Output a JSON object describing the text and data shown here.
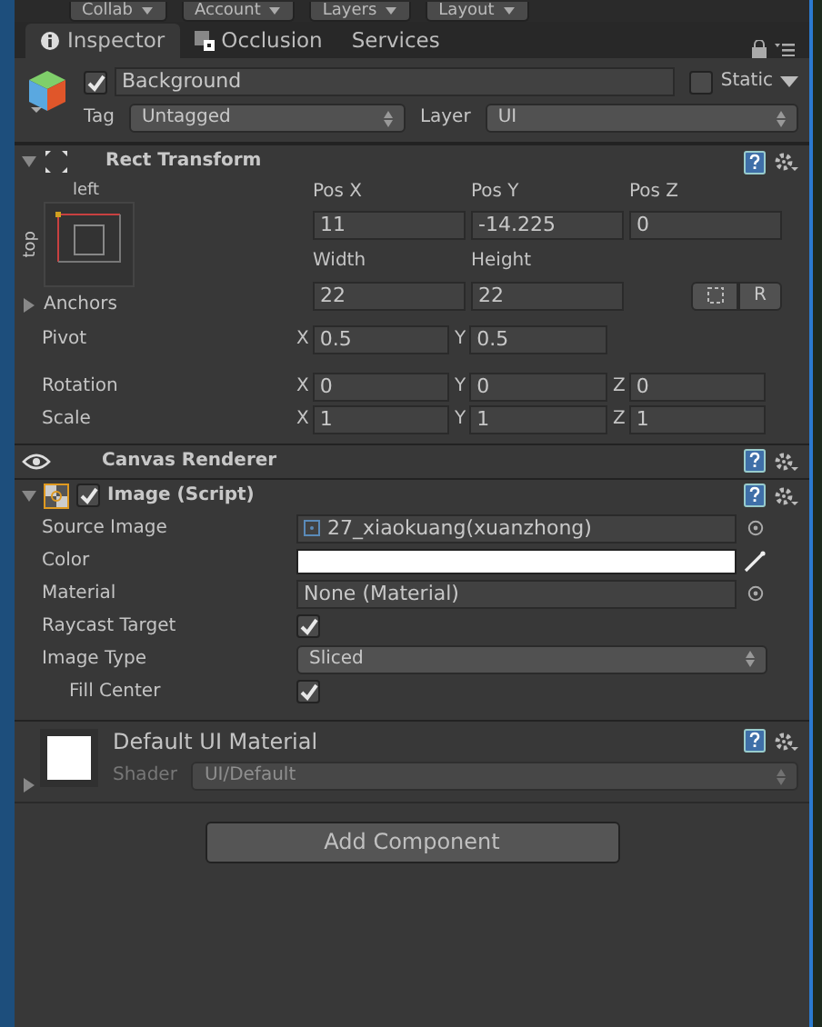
{
  "toolbar": [
    {
      "label": "Collab"
    },
    {
      "label": "Account"
    },
    {
      "label": "Layers"
    },
    {
      "label": "Layout"
    }
  ],
  "tabs": [
    {
      "label": "Inspector",
      "selected": true
    },
    {
      "label": "Occlusion",
      "selected": false
    },
    {
      "label": "Services",
      "selected": false
    }
  ],
  "object": {
    "active": true,
    "name": "Background",
    "static_label": "Static",
    "static": false,
    "tag_label": "Tag",
    "tag": "Untagged",
    "layer_label": "Layer",
    "layer": "UI"
  },
  "components": [
    {
      "kind": "rect_transform",
      "title": "Rect Transform",
      "expanded": true,
      "anchor_h": "left",
      "anchor_v": "top",
      "columns": [
        "Pos X",
        "Pos Y",
        "Pos Z"
      ],
      "values": [
        "11",
        "-14.225",
        "0"
      ],
      "size_labels": [
        "Width",
        "Height"
      ],
      "size_values": [
        "22",
        "22"
      ],
      "raw_button": "R",
      "anchors_label": "Anchors",
      "anchors_expanded": false,
      "vectors": [
        {
          "label": "Pivot",
          "axes": [
            {
              "axis": "X",
              "value": "0.5"
            },
            {
              "axis": "Y",
              "value": "0.5"
            }
          ]
        },
        {
          "label": "Rotation",
          "axes": [
            {
              "axis": "X",
              "value": "0"
            },
            {
              "axis": "Y",
              "value": "0"
            },
            {
              "axis": "Z",
              "value": "0"
            }
          ]
        },
        {
          "label": "Scale",
          "axes": [
            {
              "axis": "X",
              "value": "1"
            },
            {
              "axis": "Y",
              "value": "1"
            },
            {
              "axis": "Z",
              "value": "1"
            }
          ]
        }
      ]
    },
    {
      "kind": "canvas_renderer",
      "title": "Canvas Renderer"
    },
    {
      "kind": "script",
      "title": "Image (Script)",
      "expanded": true,
      "enabled": true,
      "properties": [
        {
          "kind": "object",
          "label": "Source Image",
          "value": "27_xiaokuang(xuanzhong)",
          "icon": true,
          "indented": false
        },
        {
          "kind": "color",
          "label": "Color",
          "color": "#ffffff",
          "indented": false
        },
        {
          "kind": "object",
          "label": "Material",
          "value": "None (Material)",
          "icon": false,
          "indented": false
        },
        {
          "kind": "toggle",
          "label": "Raycast Target",
          "checked": true,
          "indented": false
        },
        {
          "kind": "dropdown",
          "label": "Image Type",
          "value": "Sliced",
          "indented": false
        },
        {
          "kind": "toggle",
          "label": "Fill Center",
          "checked": true,
          "indented": true
        }
      ]
    },
    {
      "kind": "material",
      "title": "Default UI Material",
      "expanded": false,
      "shader_label": "Shader",
      "shader": "UI/Default"
    }
  ],
  "add_button": "Add Component"
}
